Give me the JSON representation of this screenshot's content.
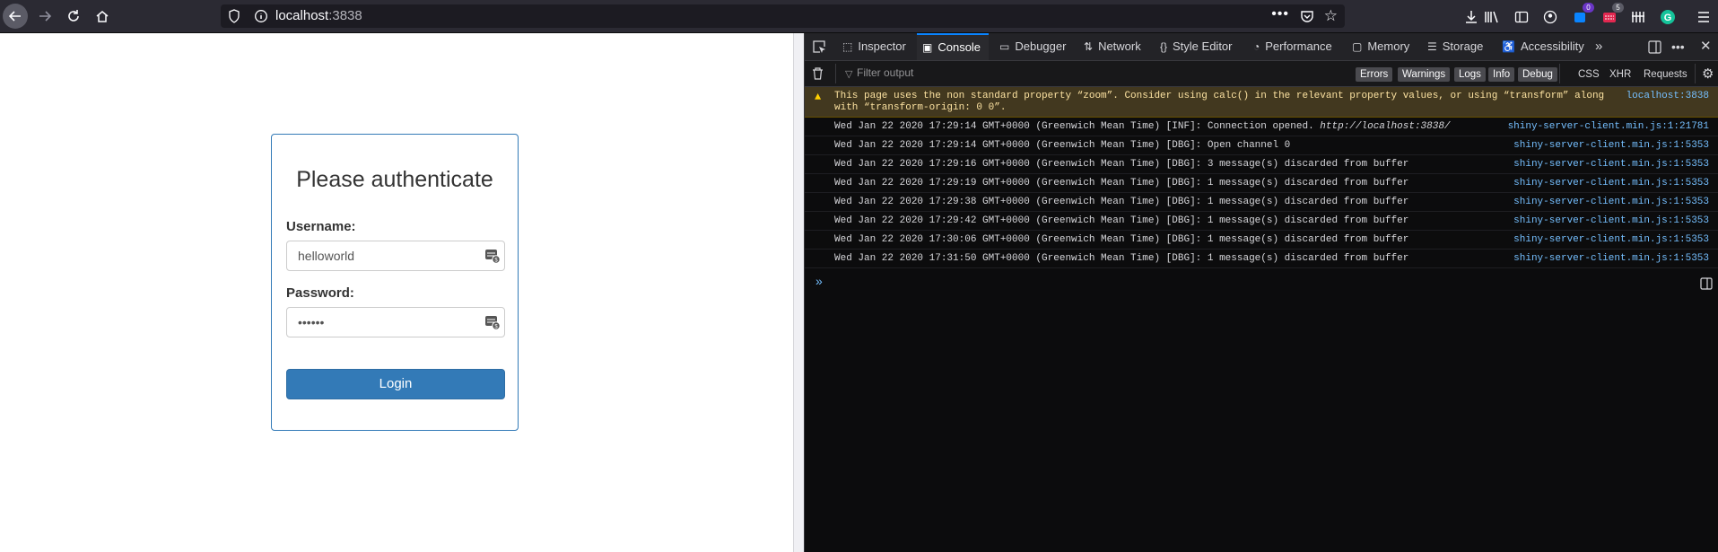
{
  "browser": {
    "url_host": "localhost",
    "url_port": ":3838",
    "toolbar_badges": {
      "extension_count": "0",
      "mail_count": "5"
    }
  },
  "page": {
    "title": "Please authenticate",
    "username_label": "Username:",
    "username_value": "helloworld",
    "password_label": "Password:",
    "password_value": "••••••",
    "login_label": "Login"
  },
  "devtools": {
    "tabs": [
      "Inspector",
      "Console",
      "Debugger",
      "Network",
      "Style Editor",
      "Performance",
      "Memory",
      "Storage",
      "Accessibility"
    ],
    "active_tab": "Console",
    "filter_placeholder": "Filter output",
    "levels": [
      "Errors",
      "Warnings",
      "Logs",
      "Info",
      "Debug"
    ],
    "types": [
      "CSS",
      "XHR",
      "Requests"
    ],
    "messages": [
      {
        "level": "warning",
        "text1": "This page uses the non standard property “zoom”. Consider using calc() in the relevant property values, or using “transform” along",
        "text2": "with “transform-origin: 0 0”.",
        "source": "localhost:3838"
      },
      {
        "level": "log",
        "text": "Wed Jan 22 2020 17:29:14 GMT+0000 (Greenwich Mean Time) [INF]: Connection opened. ",
        "link": "http://localhost:3838/",
        "source": "shiny-server-client.min.js:1:21781"
      },
      {
        "level": "log",
        "text": "Wed Jan 22 2020 17:29:14 GMT+0000 (Greenwich Mean Time) [DBG]: Open channel 0",
        "source": "shiny-server-client.min.js:1:5353"
      },
      {
        "level": "log",
        "text": "Wed Jan 22 2020 17:29:16 GMT+0000 (Greenwich Mean Time) [DBG]: 3 message(s) discarded from buffer",
        "source": "shiny-server-client.min.js:1:5353"
      },
      {
        "level": "log",
        "text": "Wed Jan 22 2020 17:29:19 GMT+0000 (Greenwich Mean Time) [DBG]: 1 message(s) discarded from buffer",
        "source": "shiny-server-client.min.js:1:5353"
      },
      {
        "level": "log",
        "text": "Wed Jan 22 2020 17:29:38 GMT+0000 (Greenwich Mean Time) [DBG]: 1 message(s) discarded from buffer",
        "source": "shiny-server-client.min.js:1:5353"
      },
      {
        "level": "log",
        "text": "Wed Jan 22 2020 17:29:42 GMT+0000 (Greenwich Mean Time) [DBG]: 1 message(s) discarded from buffer",
        "source": "shiny-server-client.min.js:1:5353"
      },
      {
        "level": "log",
        "text": "Wed Jan 22 2020 17:30:06 GMT+0000 (Greenwich Mean Time) [DBG]: 1 message(s) discarded from buffer",
        "source": "shiny-server-client.min.js:1:5353"
      },
      {
        "level": "log",
        "text": "Wed Jan 22 2020 17:31:50 GMT+0000 (Greenwich Mean Time) [DBG]: 1 message(s) discarded from buffer",
        "source": "shiny-server-client.min.js:1:5353"
      }
    ],
    "prompt_symbol": "»"
  },
  "colors": {
    "toolbar_bg": "#2b2a33",
    "primary_button": "#337ab7",
    "devtools_bg": "#0c0c0d",
    "link": "#75bfff",
    "warning_bg": "#42381f"
  }
}
